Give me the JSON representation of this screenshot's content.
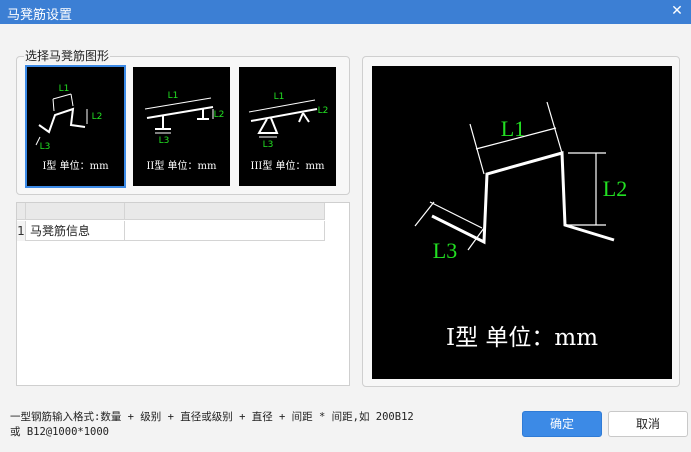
{
  "window": {
    "title": "马凳筋设置",
    "close_glyph": "✕"
  },
  "shape_group": {
    "legend": "选择马凳筋图形",
    "options": [
      {
        "caption": "I型 单位：mm",
        "labels": [
          "L1",
          "L2",
          "L3"
        ],
        "selected": true
      },
      {
        "caption": "II型 单位：mm",
        "labels": [
          "L1",
          "L2",
          "L3"
        ],
        "selected": false
      },
      {
        "caption": "III型 单位：mm",
        "labels": [
          "L1",
          "L2",
          "L3"
        ],
        "selected": false
      }
    ]
  },
  "grid": {
    "header": [
      "",
      "",
      ""
    ],
    "rows": [
      {
        "num": "1",
        "name": "马凳筋信息",
        "value": ""
      }
    ]
  },
  "preview": {
    "caption": "I型 单位：mm",
    "labels": {
      "l1": "L1",
      "l2": "L2",
      "l3": "L3"
    }
  },
  "hint": {
    "line1": "一型钢筋输入格式:数量 + 级别 + 直径或级别 + 直径 + 间距 * 间距,如 200B12",
    "line2": "或 B12@1000*1000"
  },
  "buttons": {
    "ok": "确定",
    "cancel": "取消"
  },
  "colors": {
    "title_bar": "#3c7fd4",
    "accent": "#3c8ae6",
    "dimension_label": "#22e022",
    "canvas": "#000000"
  },
  "icons": {
    "close": "close-icon"
  }
}
